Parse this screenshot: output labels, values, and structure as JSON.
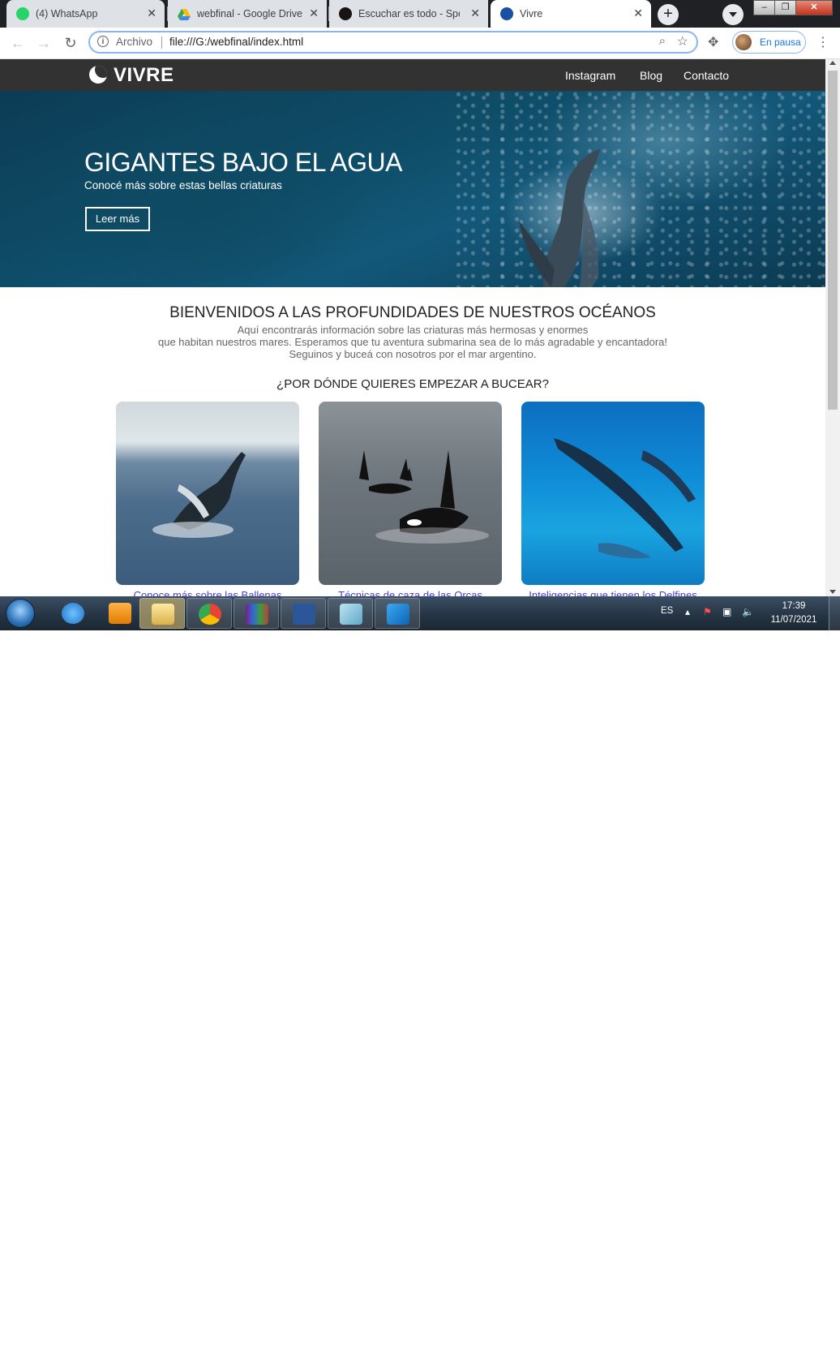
{
  "browser": {
    "tabs": [
      {
        "title": "(4) WhatsApp",
        "favicon": "whatsapp-icon",
        "favicon_color": "#25d366",
        "active": false
      },
      {
        "title": "webfinal - Google Drive",
        "favicon": "google-drive-icon",
        "favicon_color": "#fbbc04",
        "active": false
      },
      {
        "title": "Escuchar es todo - Spotify",
        "favicon": "spotify-icon",
        "favicon_color": "#191414",
        "active": false
      },
      {
        "title": "Vivre",
        "favicon": "moon-icon",
        "favicon_color": "#1a4fa3",
        "active": true
      }
    ],
    "address": {
      "security_label": "Archivo",
      "url": "file:///G:/webfinal/index.html"
    },
    "profile_label": "En pausa",
    "accent_color": "#1a73e8"
  },
  "site": {
    "logo_text": "VIVRE",
    "nav": [
      "Instagram",
      "Blog",
      "Contacto"
    ],
    "nav_bg": "#323232",
    "hero": {
      "title": "GIGANTES BAJO EL AGUA",
      "subtitle": "Conocé más sobre estas bellas criaturas",
      "button": "Leer más"
    },
    "intro": {
      "title": "BIENVENIDOS A LAS PROFUNDIDADES DE NUESTROS OCÉANOS",
      "lines": [
        "Aquí encontrarás información sobre las criaturas más hermosas y enormes",
        "que habitan nuestros mares. Esperamos que tu aventura submarina sea de lo más agradable y encantadora!",
        "Seguinos y buceá con nosotros por el mar argentino."
      ]
    },
    "section_heading": "¿POR DÓNDE QUIERES EMPEZAR A BUCEAR?",
    "cards": [
      {
        "caption": "Conoce más sobre las Ballenas",
        "image": "humpback-whale-breaching"
      },
      {
        "caption": "Técnicas de caza de las Orcas",
        "image": "orcas-swimming"
      },
      {
        "caption": "Inteligencias que tienen los Delfines",
        "image": "dolphins-underwater"
      }
    ],
    "link_color": "#4a3ad6"
  },
  "taskbar": {
    "apps": [
      "internet-explorer-icon",
      "media-player-icon",
      "file-explorer-icon",
      "chrome-icon",
      "winrar-icon",
      "word-icon",
      "app-icon",
      "vscode-icon"
    ],
    "language": "ES",
    "time": "17:39",
    "date": "11/07/2021"
  }
}
